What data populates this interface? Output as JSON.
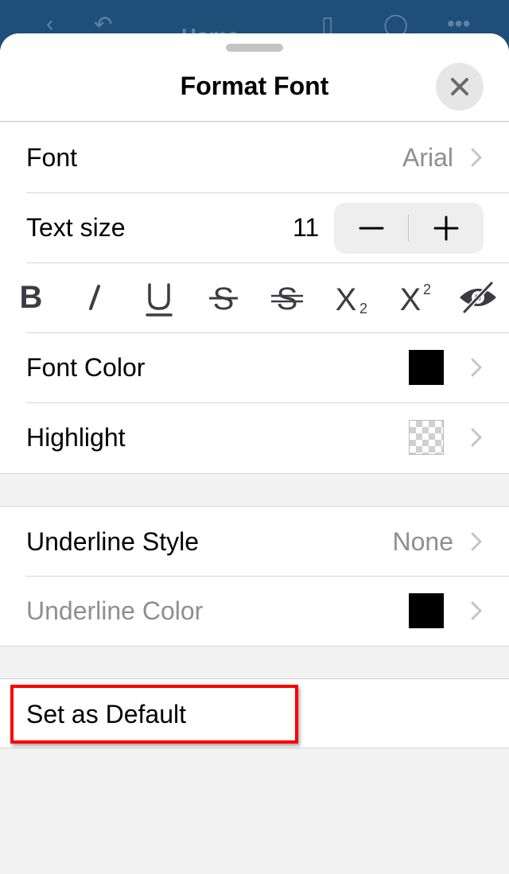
{
  "app_bar": {
    "title": "Home"
  },
  "sheet": {
    "title": "Format Font",
    "close_icon": "close-icon"
  },
  "font_row": {
    "label": "Font",
    "value": "Arial"
  },
  "text_size_row": {
    "label": "Text size",
    "value": "11",
    "decrease_icon": "minus-icon",
    "increase_icon": "plus-icon"
  },
  "format_buttons": [
    {
      "name": "bold",
      "icon": "bold-icon"
    },
    {
      "name": "italic",
      "icon": "italic-icon"
    },
    {
      "name": "underline",
      "icon": "underline-icon"
    },
    {
      "name": "strikethrough",
      "icon": "strikethrough-icon"
    },
    {
      "name": "double-strikethrough",
      "icon": "double-strikethrough-icon"
    },
    {
      "name": "subscript",
      "icon": "subscript-icon"
    },
    {
      "name": "superscript",
      "icon": "superscript-icon"
    },
    {
      "name": "hidden",
      "icon": "eye-slash-icon"
    }
  ],
  "font_color_row": {
    "label": "Font Color",
    "swatch_color": "#000000"
  },
  "highlight_row": {
    "label": "Highlight",
    "swatch": "transparent"
  },
  "underline_style_row": {
    "label": "Underline Style",
    "value": "None"
  },
  "underline_color_row": {
    "label": "Underline Color",
    "swatch_color": "#000000",
    "disabled": true
  },
  "default_row": {
    "label": "Set as Default"
  },
  "annotation": {
    "color": "#ff0000"
  },
  "colors": {
    "appbar": "#1d4f78",
    "sheet_bg": "#f2f2f2",
    "secondary_text": "#8e8e93",
    "icon_gray": "#3c3c43"
  }
}
